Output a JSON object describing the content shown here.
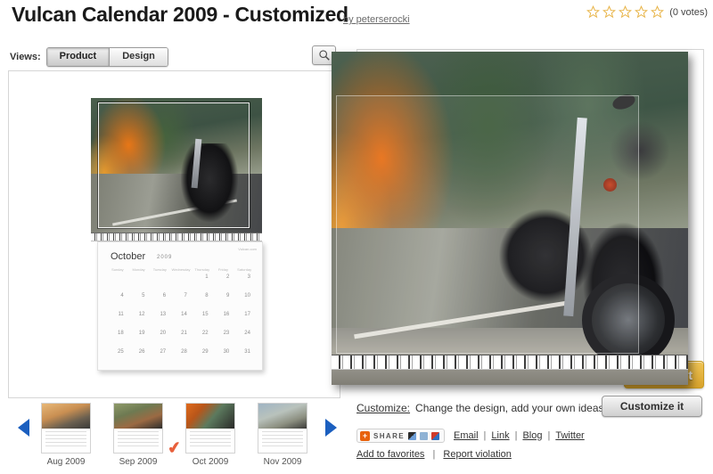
{
  "header": {
    "title": "Vulcan Calendar 2009 - Customized",
    "byline": "by peterserocki",
    "rating": {
      "stars": 5,
      "filled": 0,
      "votes_label": "(0 votes)",
      "star_color": "#e8b54a"
    }
  },
  "views": {
    "label": "Views:",
    "tabs": [
      {
        "label": "Product",
        "active": true
      },
      {
        "label": "Design",
        "active": false
      }
    ],
    "zoom_icon": "magnifier-icon"
  },
  "product": {
    "calendar": {
      "month": "October",
      "year": "2009",
      "brand": "Vulcan.com",
      "day_headers": [
        "Sunday",
        "Monday",
        "Tuesday",
        "Wednesday",
        "Thursday",
        "Friday",
        "Saturday"
      ],
      "leading_blanks": 4,
      "days": [
        1,
        2,
        3,
        4,
        5,
        6,
        7,
        8,
        9,
        10,
        11,
        12,
        13,
        14,
        15,
        16,
        17,
        18,
        19,
        20,
        21,
        22,
        23,
        24,
        25,
        26,
        27,
        28,
        29,
        30,
        31
      ]
    }
  },
  "cart": {
    "label": "cart"
  },
  "customize": {
    "link_label": "Customize:",
    "text": "Change the design, add your own ideas!",
    "button_label": "Customize it"
  },
  "share": {
    "addthis_label": "SHARE",
    "addthis_plus": "+",
    "links": [
      "Email",
      "Link",
      "Blog",
      "Twitter"
    ],
    "separator": "|"
  },
  "meta": {
    "links": [
      "Add to favorites",
      "Report violation"
    ],
    "separator": "|"
  },
  "thumbnails": {
    "prev_label": "previous",
    "next_label": "next",
    "selected_index": 2,
    "check_glyph": "✔",
    "items": [
      {
        "caption": "Aug 2009"
      },
      {
        "caption": "Sep 2009"
      },
      {
        "caption": "Oct 2009"
      },
      {
        "caption": "Nov 2009"
      }
    ]
  }
}
